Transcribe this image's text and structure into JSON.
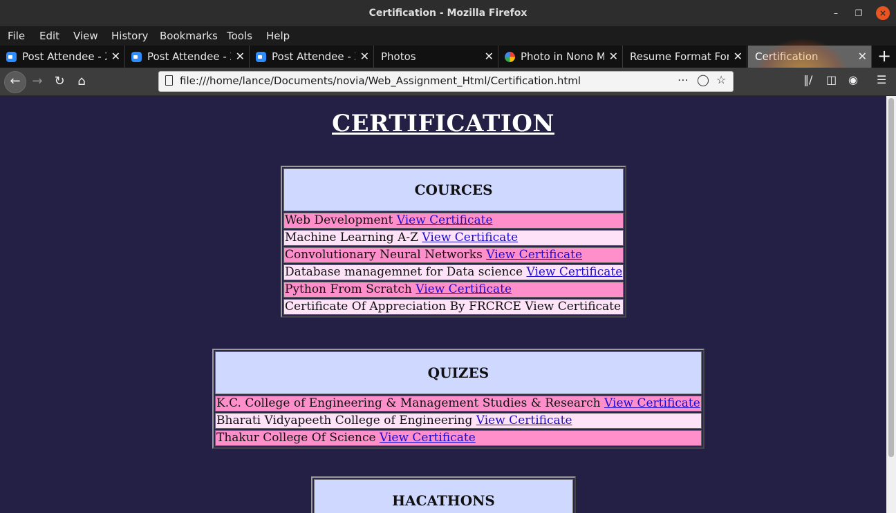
{
  "window": {
    "title": "Certification - Mozilla Firefox"
  },
  "menu": [
    "File",
    "Edit",
    "View",
    "History",
    "Bookmarks",
    "Tools",
    "Help"
  ],
  "tabs": [
    {
      "label": "Post Attendee - Zoom",
      "icon": "zoom-icon",
      "active": false
    },
    {
      "label": "Post Attendee - Zoom",
      "icon": "zoom-icon",
      "active": false
    },
    {
      "label": "Post Attendee - Zoom",
      "icon": "zoom-icon",
      "active": false
    },
    {
      "label": "Photos",
      "icon": "",
      "active": false
    },
    {
      "label": "Photo in Nono Mor",
      "icon": "google-photos-icon",
      "active": false
    },
    {
      "label": "Resume Format For",
      "icon": "",
      "active": false
    },
    {
      "label": "Certification",
      "icon": "",
      "active": true
    }
  ],
  "address": {
    "url": "file:///home/lance/Documents/novia/Web_Assignment_Html/Certification.html"
  },
  "page": {
    "title": "CERTIFICATION",
    "courses": {
      "header": "COURCES",
      "rows": [
        {
          "text": "Web Development",
          "link": "View Certificate"
        },
        {
          "text": "Machine Learning A-Z",
          "link": "View Certificate"
        },
        {
          "text": "Convolutionary Neural Networks",
          "link": "View Certificate"
        },
        {
          "text": "Database managemnet for Data science",
          "link": "View Certificate"
        },
        {
          "text": "Python From Scratch",
          "link": "View Certificate"
        },
        {
          "text": "Certificate Of Appreciation By FRCRCE",
          "link": "View Certificate"
        }
      ]
    },
    "quizes": {
      "header": "QUIZES",
      "rows": [
        {
          "text": "K.C. College of Engineering & Management Studies & Research",
          "link": "View Certificate"
        },
        {
          "text": "Bharati Vidyapeeth College of Engineering",
          "link": "View Certificate"
        },
        {
          "text": "Thakur College Of Science",
          "link": "View Certificate"
        }
      ]
    },
    "hackathons": {
      "header": "HACATHONS"
    }
  },
  "colors": {
    "page_bg": "#241f45",
    "header_cell": "#cfd8ff",
    "row_pink": "#ff8fcb",
    "row_light": "#fde2f8",
    "link": "#1a0dcc"
  }
}
